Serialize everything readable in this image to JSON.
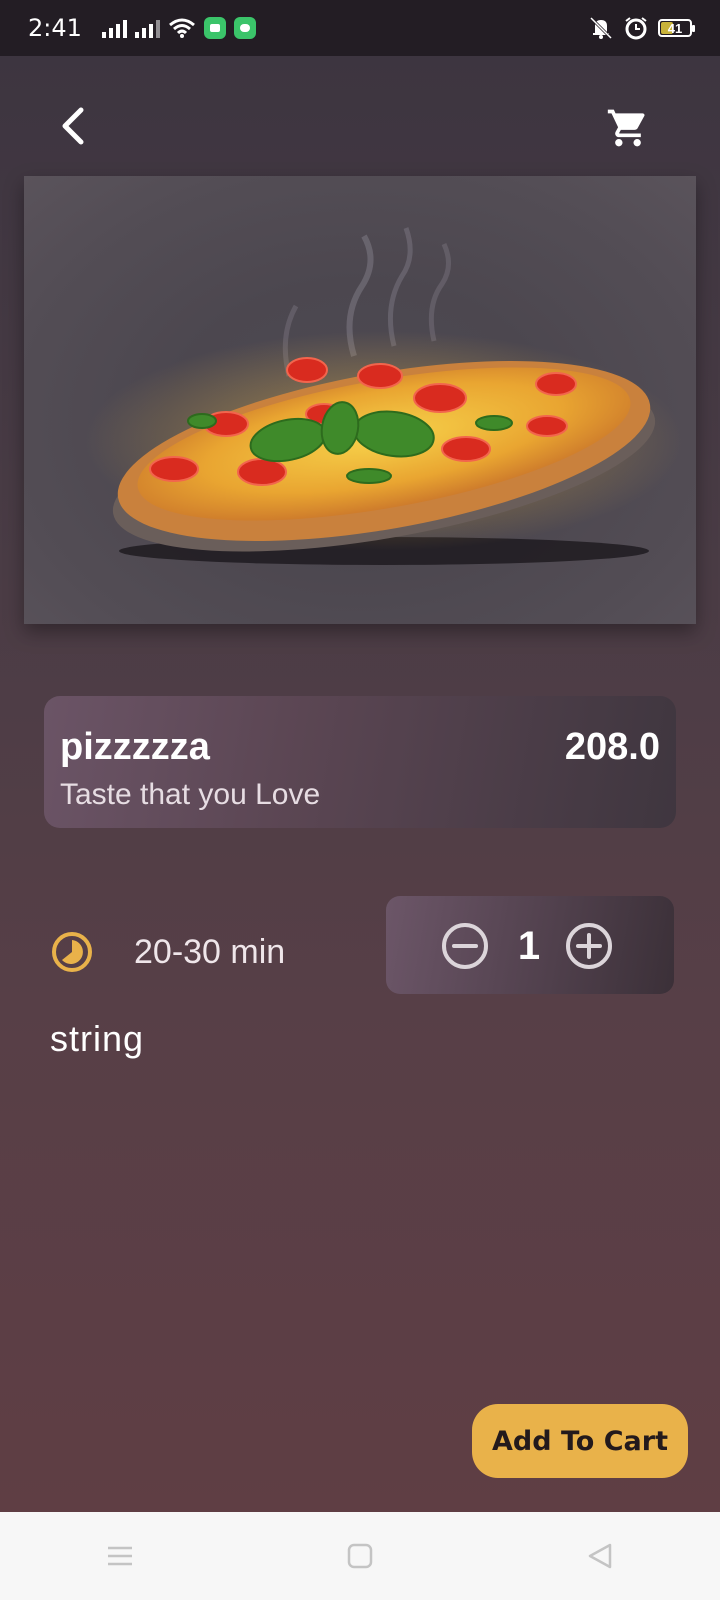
{
  "status_bar": {
    "time": "2:41",
    "battery": "41"
  },
  "product": {
    "name": "pizzzzza",
    "price": "208.0",
    "tagline": "Taste that you Love",
    "delivery_time": "20-30 min",
    "description": "string",
    "quantity": "1"
  },
  "actions": {
    "add_to_cart": "Add To Cart"
  },
  "icons": [
    "back-arrow-icon",
    "cart-icon",
    "clock-icon",
    "minus-circle-icon",
    "plus-circle-icon"
  ],
  "colors": {
    "accent": "#e9b24a",
    "card": "#5b4653",
    "background": "#5a3f45"
  }
}
